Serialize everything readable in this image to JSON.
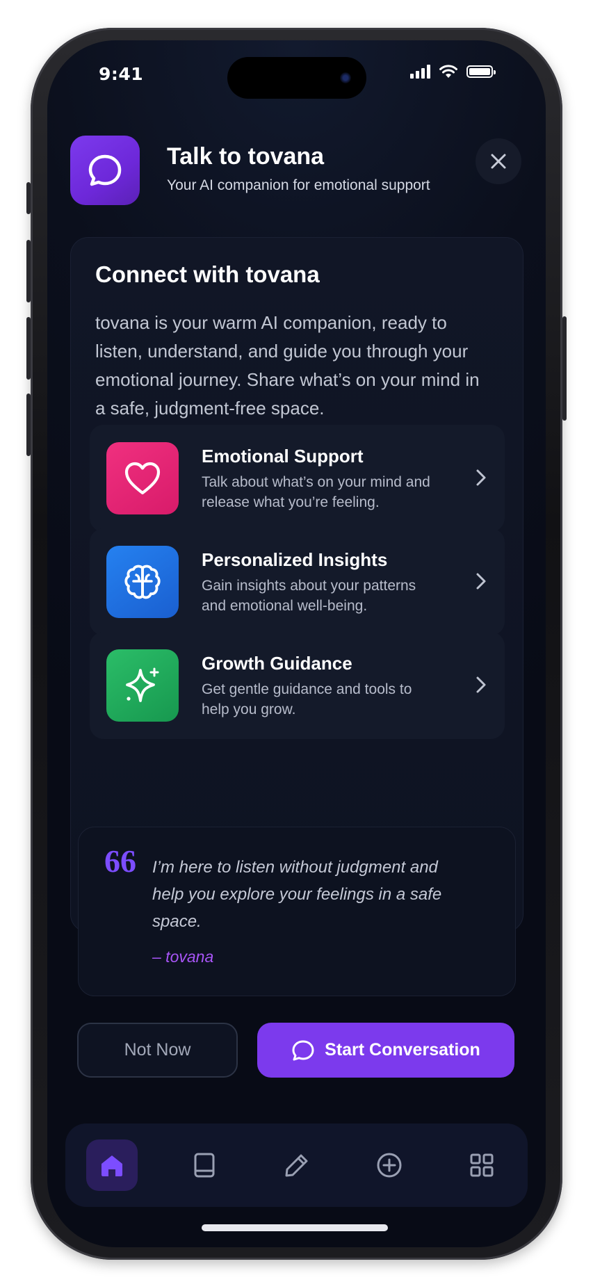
{
  "status_bar": {
    "time": "9:41"
  },
  "header": {
    "title": "Talk to tovana",
    "subtitle": "Your AI companion for emotional support",
    "icon": "chat-bubble-icon",
    "close_icon": "close-icon"
  },
  "card": {
    "title": "Connect with tovana",
    "description": "tovana is your warm AI companion, ready to listen, understand, and guide you through your emotional journey. Share what’s on your mind in a safe, judgment-free space."
  },
  "features": [
    {
      "title": "Emotional Support",
      "description": "Talk about what’s on your mind and release what you’re feeling.",
      "icon": "heart-icon",
      "color": "#e91e78"
    },
    {
      "title": "Personalized Insights",
      "description": "Gain insights about your patterns and emotional well-being.",
      "icon": "brain-icon",
      "color": "#1d6fe0"
    },
    {
      "title": "Growth Guidance",
      "description": "Get gentle guidance and tools to help you grow.",
      "icon": "sparkle-icon",
      "color": "#1fa85a"
    }
  ],
  "quote": {
    "mark": "66",
    "text": "I’m here to listen without judgment and help you explore your feelings in a safe space.",
    "author": "– tovana"
  },
  "actions": {
    "secondary_label": "Not Now",
    "primary_label": "Start Conversation"
  },
  "tabbar": {
    "items": [
      {
        "icon": "home-icon",
        "active": true
      },
      {
        "icon": "book-icon",
        "active": false
      },
      {
        "icon": "pencil-icon",
        "active": false
      },
      {
        "icon": "plus-circle-icon",
        "active": false
      },
      {
        "icon": "grid-icon",
        "active": false
      }
    ]
  },
  "colors": {
    "accent": "#7c3aed",
    "background": "#0b0f1c",
    "quote_author": "#a855f7"
  }
}
